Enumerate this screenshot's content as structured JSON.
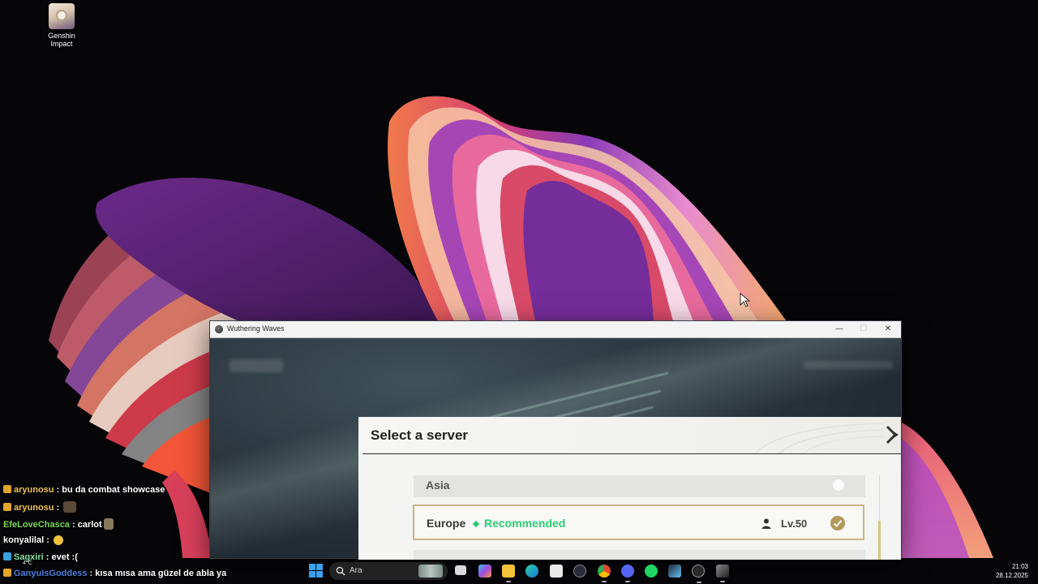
{
  "desktop": {
    "icons": [
      {
        "label": "Genshin Impact"
      }
    ]
  },
  "window": {
    "title": "Wuthering Waves",
    "minimize_glyph": "—",
    "maximize_glyph": "☐",
    "close_glyph": "✕"
  },
  "dialog": {
    "title": "Select a server",
    "servers": [
      {
        "name": "Asia",
        "selected": false
      },
      {
        "name": "Europe",
        "tag": "Recommended",
        "level": "Lv.50",
        "selected": true,
        "tag_color": "#2ecc71"
      }
    ],
    "accent_color": "#c8b587"
  },
  "chat": {
    "messages": [
      {
        "user": "aryunosu",
        "text": " : bu da combat showcase",
        "user_color": "#f0c44a",
        "badge_color": "#e0a62a"
      },
      {
        "user": "aryunosu",
        "text": " : ",
        "user_color": "#f0c44a",
        "badge_color": "#e0a62a",
        "emote": true
      },
      {
        "user": "EfeLoveChasca",
        "text": " : carlot",
        "user_color": "#7bd854",
        "emote": true
      },
      {
        "user": "konyalilal",
        "text": " : ",
        "user_color": "#ffffff",
        "emote": true
      },
      {
        "user": "Sagxiri",
        "text": " : evet :(",
        "user_color": "#7fe3a0",
        "badge_color": "#3aa0e0"
      },
      {
        "user": "GanyuIsGoddess",
        "text": " : kısa mısa ama güzel de abla ya",
        "user_color": "#4a7fe0",
        "badge_color": "#e0a62a"
      }
    ]
  },
  "taskbar": {
    "weather": "4°C",
    "search_placeholder": "Ara",
    "apps": [
      "task-view",
      "copilot",
      "file-explorer",
      "edge",
      "store",
      "app-store",
      "chrome",
      "discord",
      "spotify",
      "steam",
      "game-launcher",
      "wuthering-waves"
    ],
    "time": "21:03",
    "date": "28.12.2025"
  }
}
